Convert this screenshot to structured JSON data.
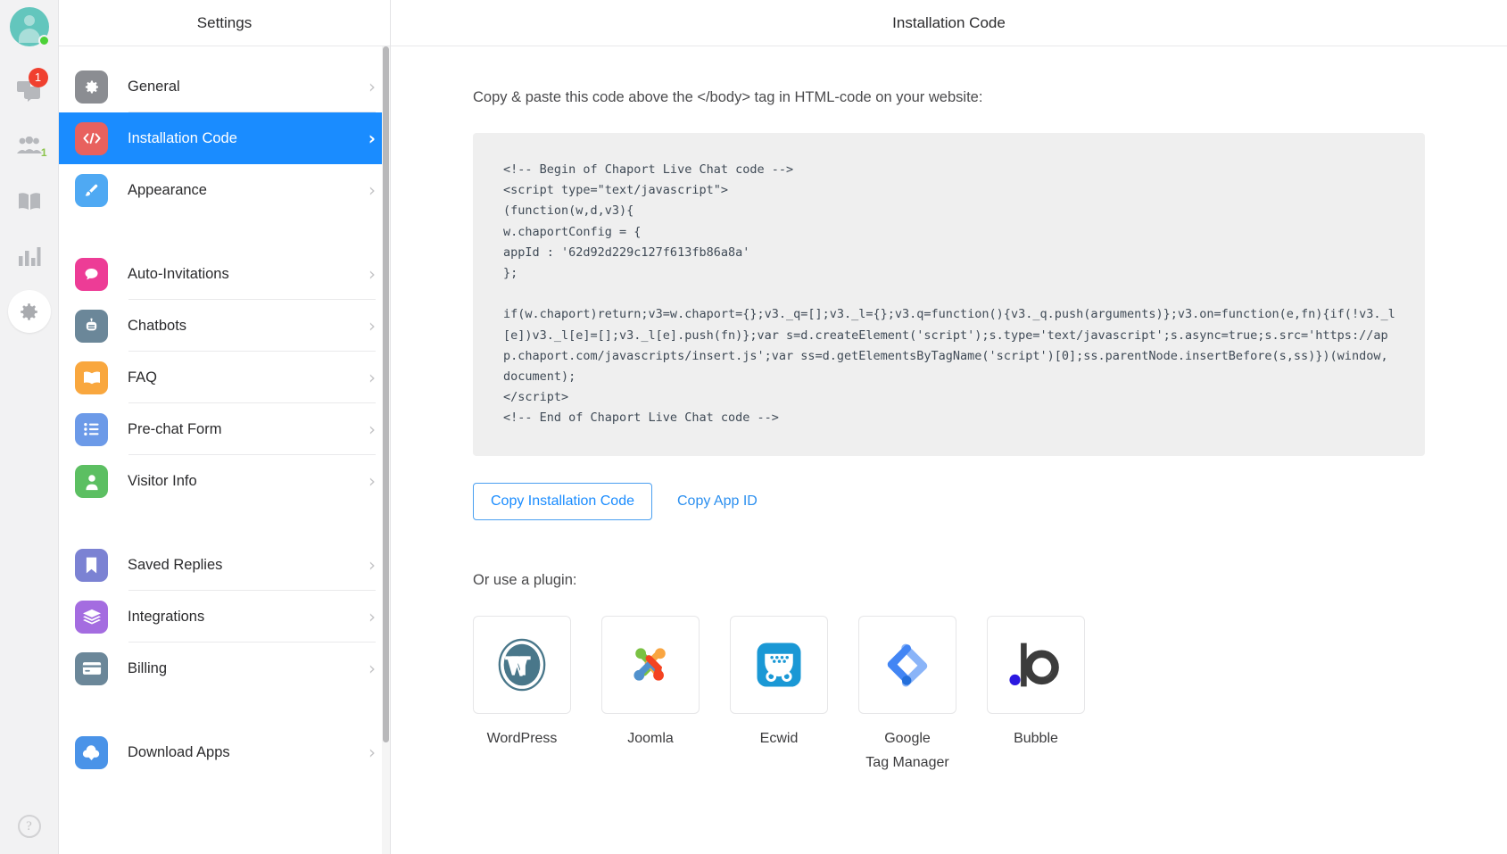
{
  "rail": {
    "avatar": {
      "icon": "user-avatar",
      "status": "online"
    },
    "items": [
      {
        "icon": "chat-bubbles-icon",
        "badge": "1"
      },
      {
        "icon": "visitors-people-icon",
        "badge": "1"
      },
      {
        "icon": "book-icon",
        "badge": ""
      },
      {
        "icon": "bar-chart-icon",
        "badge": ""
      },
      {
        "icon": "gear-icon",
        "badge": ""
      }
    ],
    "help": "?"
  },
  "settings": {
    "title": "Settings",
    "groups": [
      {
        "items": [
          {
            "label": "General",
            "icon": "gear-icon",
            "color": "#8b8d92",
            "active": false
          },
          {
            "label": "Installation Code",
            "icon": "code-brackets-icon",
            "color": "#e8615e",
            "active": true
          },
          {
            "label": "Appearance",
            "icon": "paintbrush-icon",
            "color": "#4fa9f3",
            "active": false
          }
        ]
      },
      {
        "items": [
          {
            "label": "Auto-Invitations",
            "icon": "speech-bubble-icon",
            "color": "#ed3c96",
            "active": false
          },
          {
            "label": "Chatbots",
            "icon": "robot-icon",
            "color": "#6b8799",
            "active": false
          },
          {
            "label": "FAQ",
            "icon": "open-book-icon",
            "color": "#f9a73e",
            "active": false
          },
          {
            "label": "Pre-chat Form",
            "icon": "list-icon",
            "color": "#6c9ae8",
            "active": false
          },
          {
            "label": "Visitor Info",
            "icon": "person-icon",
            "color": "#5cbf62",
            "active": false
          }
        ]
      },
      {
        "items": [
          {
            "label": "Saved Replies",
            "icon": "bookmark-icon",
            "color": "#7b82d3",
            "active": false
          },
          {
            "label": "Integrations",
            "icon": "layers-icon",
            "color": "#a46ce0",
            "active": false
          },
          {
            "label": "Billing",
            "icon": "credit-card-icon",
            "color": "#6b8799",
            "active": false
          }
        ]
      },
      {
        "items": [
          {
            "label": "Download Apps",
            "icon": "cloud-download-icon",
            "color": "#4a93e8",
            "active": false
          }
        ]
      }
    ]
  },
  "main": {
    "title": "Installation Code",
    "intro": "Copy & paste this code above the </body> tag in HTML-code on your website:",
    "app_id": "62d92d229c127f613fb86a8a",
    "code": "<!-- Begin of Chaport Live Chat code -->\n<script type=\"text/javascript\">\n(function(w,d,v3){\nw.chaportConfig = {\nappId : '62d92d229c127f613fb86a8a'\n};\n\nif(w.chaport)return;v3=w.chaport={};v3._q=[];v3._l={};v3.q=function(){v3._q.push(arguments)};v3.on=function(e,fn){if(!v3._l[e])v3._l[e]=[];v3._l[e].push(fn)};var s=d.createElement('script');s.type='text/javascript';s.async=true;s.src='https://app.chaport.com/javascripts/insert.js';var ss=d.getElementsByTagName('script')[0];ss.parentNode.insertBefore(s,ss)})(window, document);\n</script>\n<!-- End of Chaport Live Chat code -->",
    "copy_code_button": "Copy Installation Code",
    "copy_app_id_link": "Copy App ID",
    "plugin_title": "Or use a plugin:",
    "plugins": [
      {
        "name": "WordPress",
        "icon": "wordpress-logo"
      },
      {
        "name": "Joomla",
        "icon": "joomla-logo"
      },
      {
        "name": "Ecwid",
        "icon": "ecwid-logo"
      },
      {
        "name": "Google\nTag Manager",
        "icon": "google-tag-manager-logo"
      },
      {
        "name": "Bubble",
        "icon": "bubble-logo"
      }
    ]
  },
  "colors": {
    "accent": "#1a8cff",
    "link": "#2b8fef",
    "badge": "#f0402f",
    "online": "#4cd137"
  }
}
